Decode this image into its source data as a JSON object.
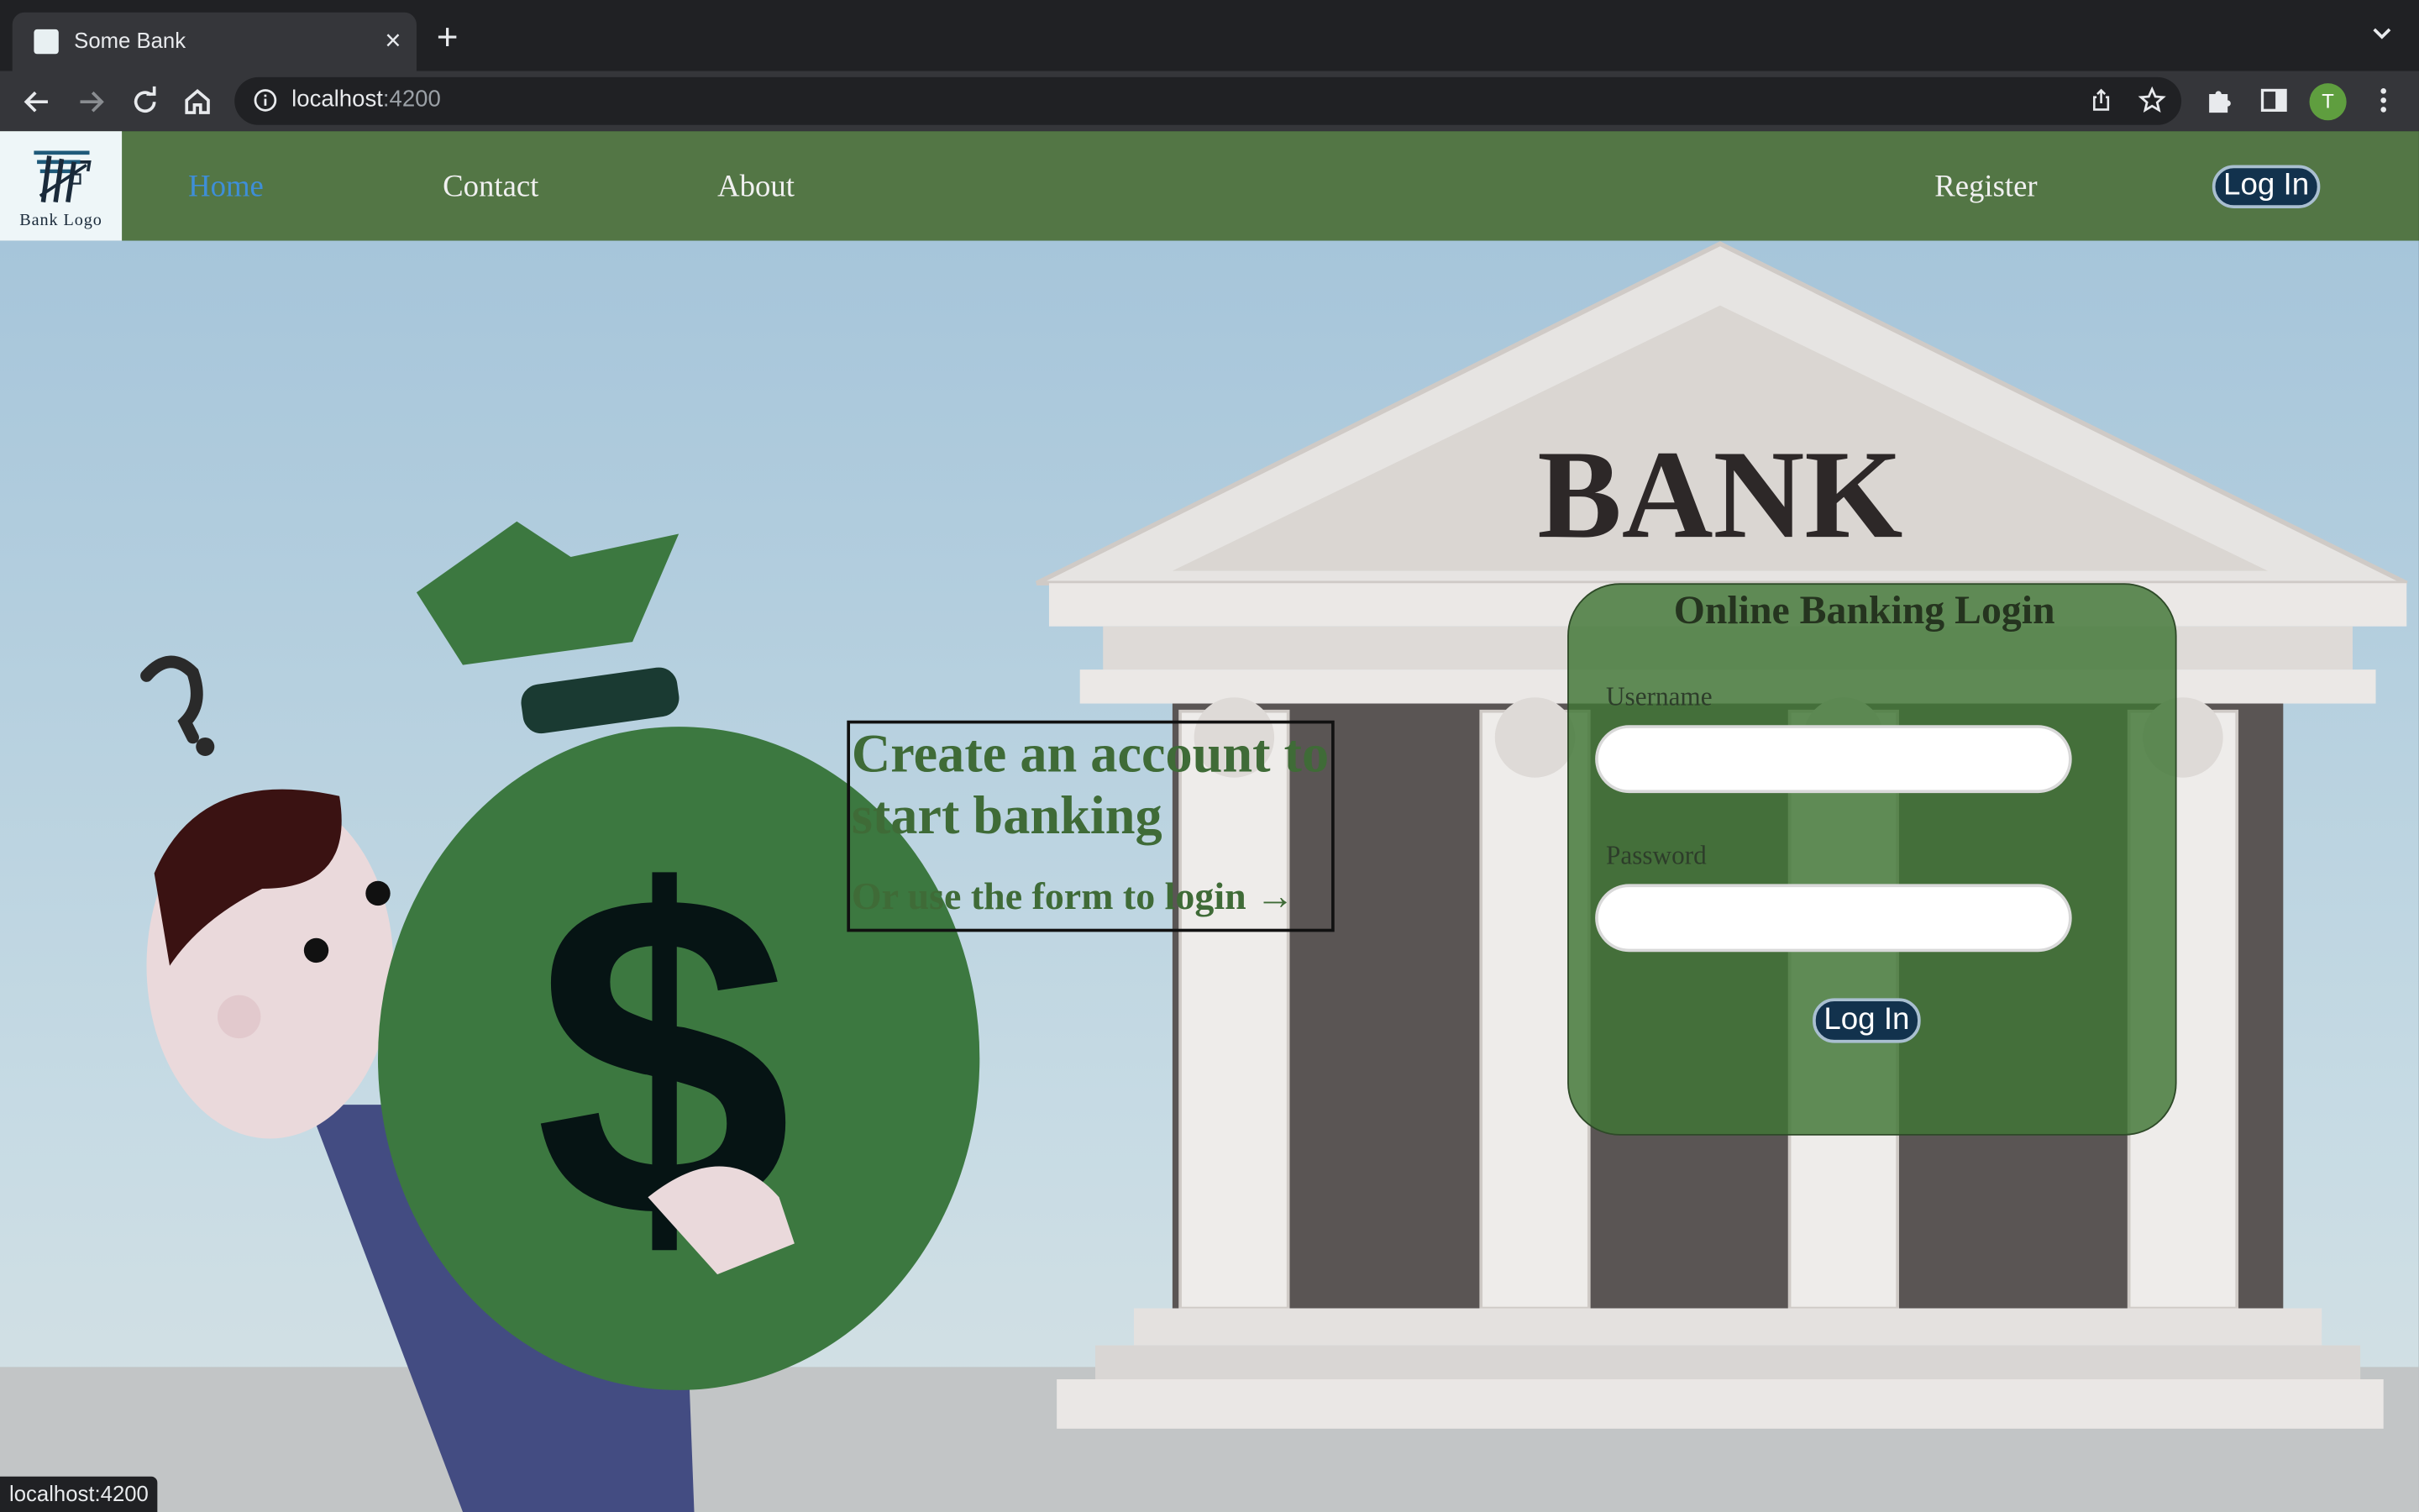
{
  "browser": {
    "tab_title": "Some Bank",
    "tab_close_glyph": "×",
    "new_tab_glyph": "+",
    "url_host": "localhost",
    "url_port": ":4200",
    "profile_initial": "T",
    "status_url": "localhost:4200"
  },
  "site": {
    "logo_text": "Bank Logo",
    "nav": {
      "home": "Home",
      "contact": "Contact",
      "about": "About",
      "register": "Register",
      "login": "Log In"
    },
    "building_sign": "BANK",
    "cta": {
      "title": "Create an account to start banking",
      "subtitle": "Or use the form to login →"
    },
    "login_form": {
      "title": "Online Banking Login",
      "username_label": "Username",
      "username_value": "",
      "password_label": "Password",
      "password_value": "",
      "submit_label": "Log In"
    }
  },
  "colors": {
    "navbar_bg": "#537645",
    "accent_link": "#3e8ed8",
    "button_bg": "#12324d",
    "card_bg": "#3f7534",
    "heading_green": "#3f6b37"
  },
  "icons": [
    "bank-favicon-icon",
    "close-icon",
    "plus-icon",
    "chevron-down-icon",
    "back-arrow-icon",
    "forward-arrow-icon",
    "reload-icon",
    "home-icon",
    "info-icon",
    "share-icon",
    "star-icon",
    "puzzle-icon",
    "sidepanel-icon",
    "kebab-menu-icon"
  ]
}
